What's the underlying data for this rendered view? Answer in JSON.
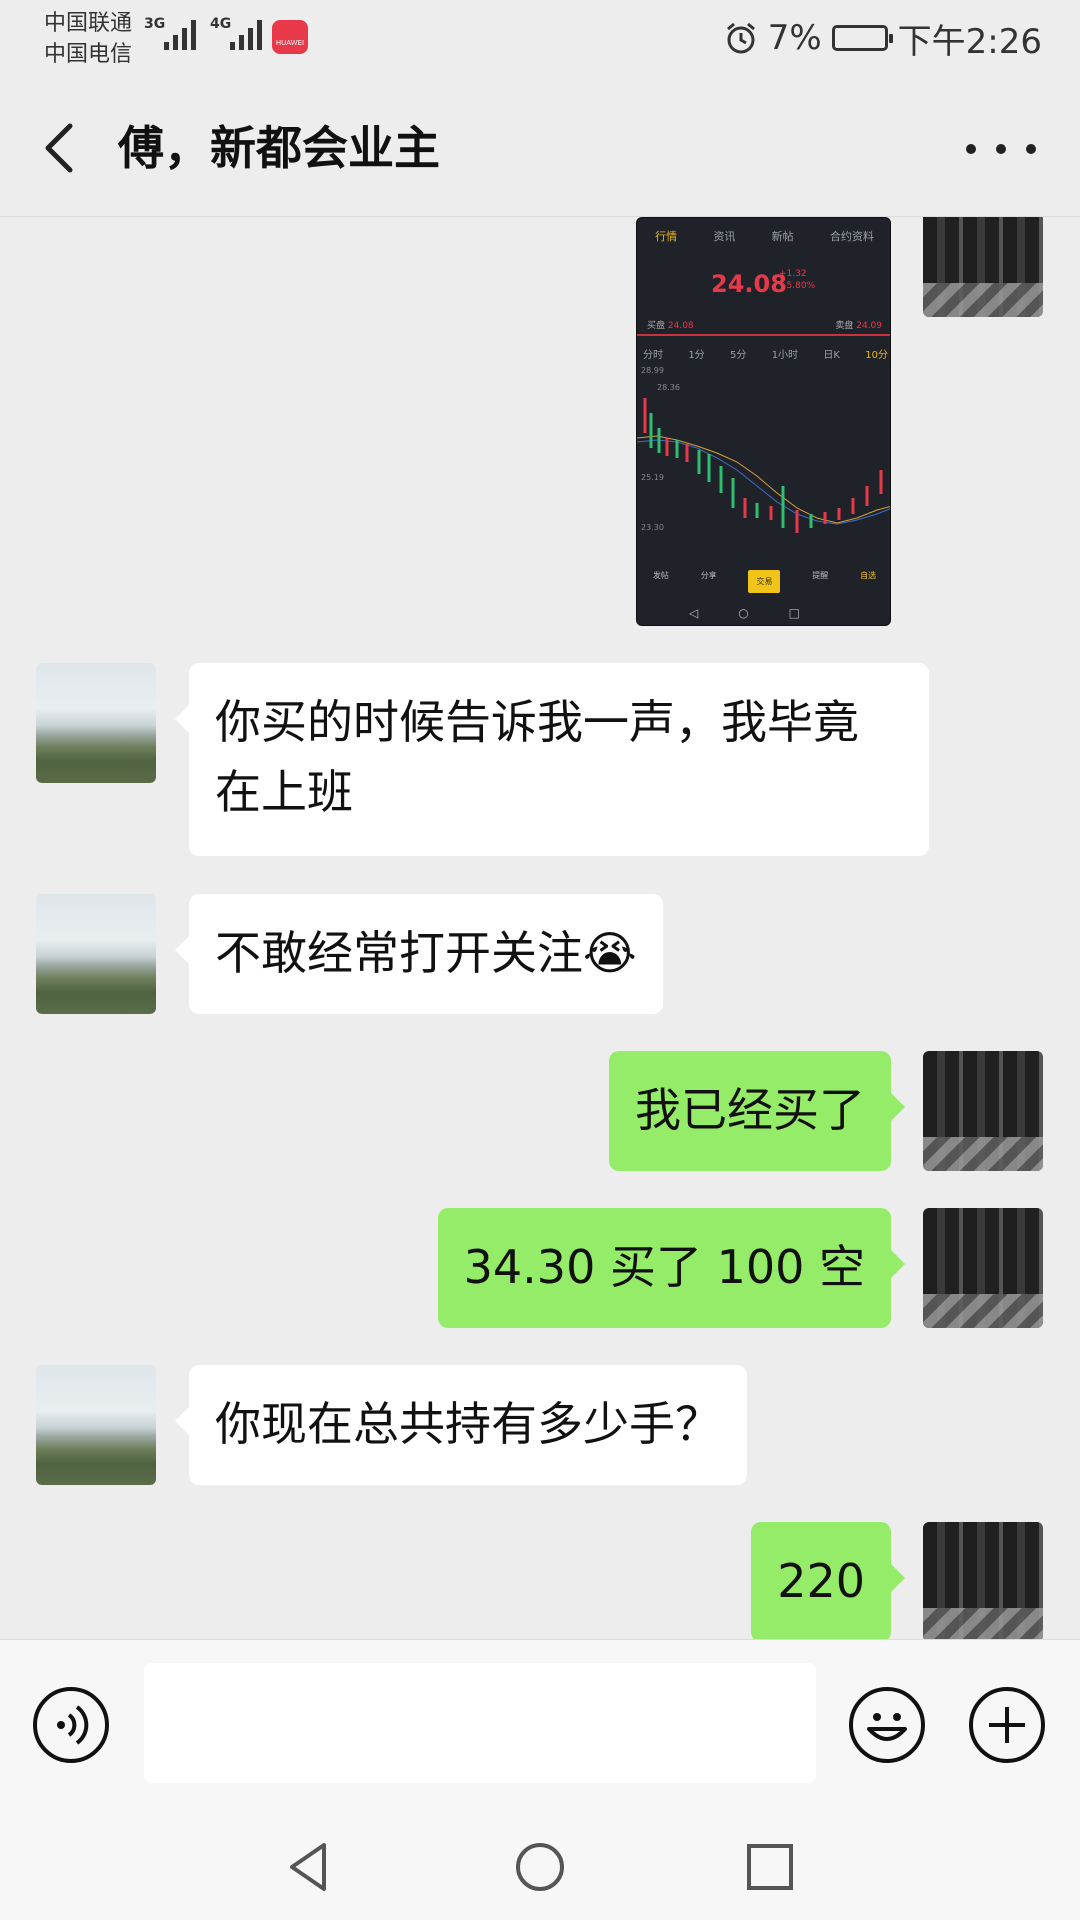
{
  "status_bar": {
    "carrier_1": "中国联通",
    "carrier_2": "中国电信",
    "net_1": "3G",
    "net_2": "4G",
    "app_badge": "HUAWEI",
    "battery": "7%",
    "time": "下午2:26"
  },
  "header": {
    "title": "傅，新都会业主"
  },
  "shared_image": {
    "tabs": [
      "行情",
      "资讯",
      "新帖",
      "合约资料"
    ],
    "price": "24.08",
    "change": "+1.32",
    "change_pct": "+5.80%",
    "bid_label": "买盘",
    "bid": "24.08",
    "ask_label": "卖盘",
    "ask": "24.09",
    "periods": [
      "分时",
      "1分",
      "5分",
      "1小时",
      "日K",
      "10分"
    ],
    "y_labels": [
      "28.99",
      "28.36",
      "25.19",
      "23.30"
    ],
    "nav": [
      "发帖",
      "分享",
      "交易",
      "提醒",
      "自选"
    ]
  },
  "messages": [
    {
      "side": "left",
      "text": "你买的时候告诉我一声，我毕竟在上班"
    },
    {
      "side": "left",
      "text": "不敢经常打开关注😭"
    },
    {
      "side": "right",
      "text": "我已经买了"
    },
    {
      "side": "right",
      "text": "34.30 买了 100 空"
    },
    {
      "side": "left",
      "text": "你现在总共持有多少手？"
    },
    {
      "side": "right",
      "text": "220"
    }
  ],
  "input": {
    "value": "",
    "placeholder": ""
  },
  "colors": {
    "sent_bubble": "#95ec69",
    "received_bubble": "#ffffff",
    "background": "#ededed",
    "accent_red": "#e8394a",
    "accent_yellow": "#f0c419"
  }
}
